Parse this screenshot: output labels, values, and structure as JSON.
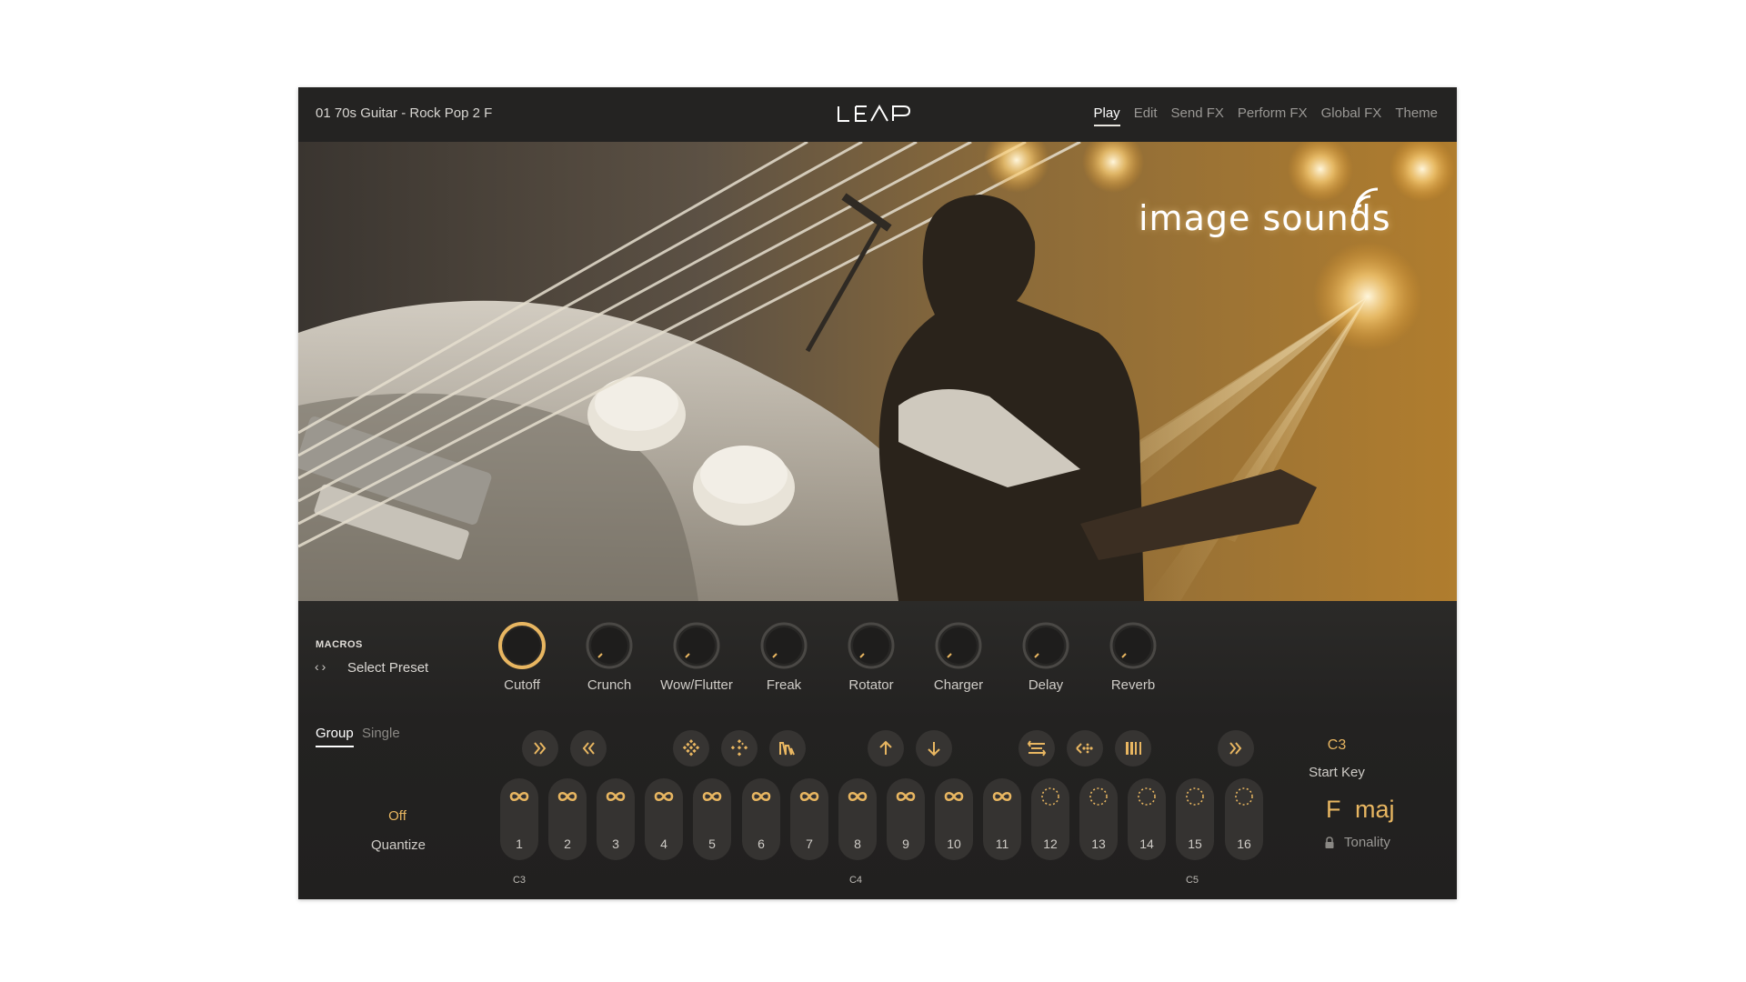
{
  "header": {
    "preset_name": "01 70s Guitar - Rock Pop 2 F",
    "logo_text": "LEAP",
    "tabs": [
      {
        "label": "Play",
        "active": true
      },
      {
        "label": "Edit"
      },
      {
        "label": "Send FX"
      },
      {
        "label": "Perform FX"
      },
      {
        "label": "Global FX"
      },
      {
        "label": "Theme"
      }
    ]
  },
  "artwork": {
    "brand_text": "image sounds",
    "brand_icon": "broadcast-waves-icon"
  },
  "macros": {
    "title": "MACROS",
    "select_preset": "Select Preset",
    "knobs": [
      {
        "label": "Cutoff",
        "active": true
      },
      {
        "label": "Crunch"
      },
      {
        "label": "Wow/Flutter"
      },
      {
        "label": "Freak"
      },
      {
        "label": "Rotator"
      },
      {
        "label": "Charger"
      },
      {
        "label": "Delay"
      },
      {
        "label": "Reverb"
      }
    ]
  },
  "mode_tabs": {
    "group": "Group",
    "single": "Single"
  },
  "quantize": {
    "value": "Off",
    "label": "Quantize"
  },
  "fx_buttons": [
    "fast-forward-icon",
    "rewind-icon",
    "stutter-diamond-icon",
    "scatter-diamond-icon",
    "pulse-wave-icon",
    "pitch-up-icon",
    "pitch-down-icon",
    "reverse-loop-icon",
    "reverse-dots-icon",
    "gate-bars-icon",
    "fast-forward-icon"
  ],
  "pads": [
    {
      "number": "1",
      "type": "loop"
    },
    {
      "number": "2",
      "type": "loop"
    },
    {
      "number": "3",
      "type": "loop"
    },
    {
      "number": "4",
      "type": "loop"
    },
    {
      "number": "5",
      "type": "loop"
    },
    {
      "number": "6",
      "type": "loop"
    },
    {
      "number": "7",
      "type": "loop"
    },
    {
      "number": "8",
      "type": "loop"
    },
    {
      "number": "9",
      "type": "loop"
    },
    {
      "number": "10",
      "type": "loop"
    },
    {
      "number": "11",
      "type": "loop"
    },
    {
      "number": "12",
      "type": "one-shot"
    },
    {
      "number": "13",
      "type": "one-shot"
    },
    {
      "number": "14",
      "type": "one-shot"
    },
    {
      "number": "15",
      "type": "one-shot"
    },
    {
      "number": "16",
      "type": "one-shot"
    }
  ],
  "octave_labels": {
    "first": "C3",
    "second": "C4",
    "third": "C5"
  },
  "start_key": {
    "value": "C3",
    "label": "Start Key"
  },
  "tonality": {
    "root": "F",
    "mode": "maj",
    "label": "Tonality"
  },
  "colors": {
    "accent": "#e8b661",
    "background": "#222120",
    "pad": "#353331"
  }
}
